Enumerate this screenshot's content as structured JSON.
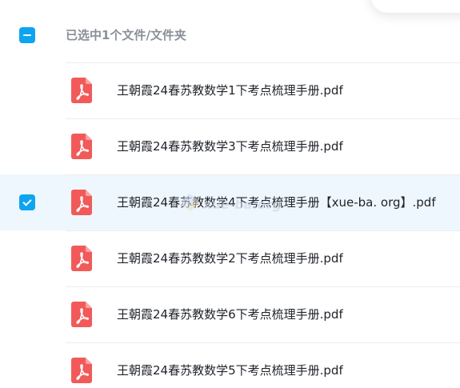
{
  "header": {
    "selection_text": "已选中1个文件/文件夹",
    "select_all_state": "partial"
  },
  "files": [
    {
      "name": "王朝霞24春苏教数学1下考点梳理手册.pdf",
      "selected": false,
      "icon": "pdf-icon"
    },
    {
      "name": "王朝霞24春苏教数学3下考点梳理手册.pdf",
      "selected": false,
      "icon": "pdf-icon"
    },
    {
      "name": "王朝霞24春苏教数学4下考点梳理手册【xue-ba. org】.pdf",
      "selected": true,
      "icon": "pdf-icon"
    },
    {
      "name": "王朝霞24春苏教数学2下考点梳理手册.pdf",
      "selected": false,
      "icon": "pdf-icon"
    },
    {
      "name": "王朝霞24春苏教数学6下考点梳理手册.pdf",
      "selected": false,
      "icon": "pdf-icon"
    },
    {
      "name": "王朝霞24春苏教数学5下考点梳理手册.pdf",
      "selected": false,
      "icon": "pdf-icon"
    }
  ],
  "watermark": {
    "text": "xue-ba.org"
  },
  "colors": {
    "accent": "#0ea5f0",
    "pdf_red": "#f25a5a",
    "selected_row_bg": "#eef7fd",
    "header_text": "#8a8f98",
    "file_text": "#1f2329"
  }
}
